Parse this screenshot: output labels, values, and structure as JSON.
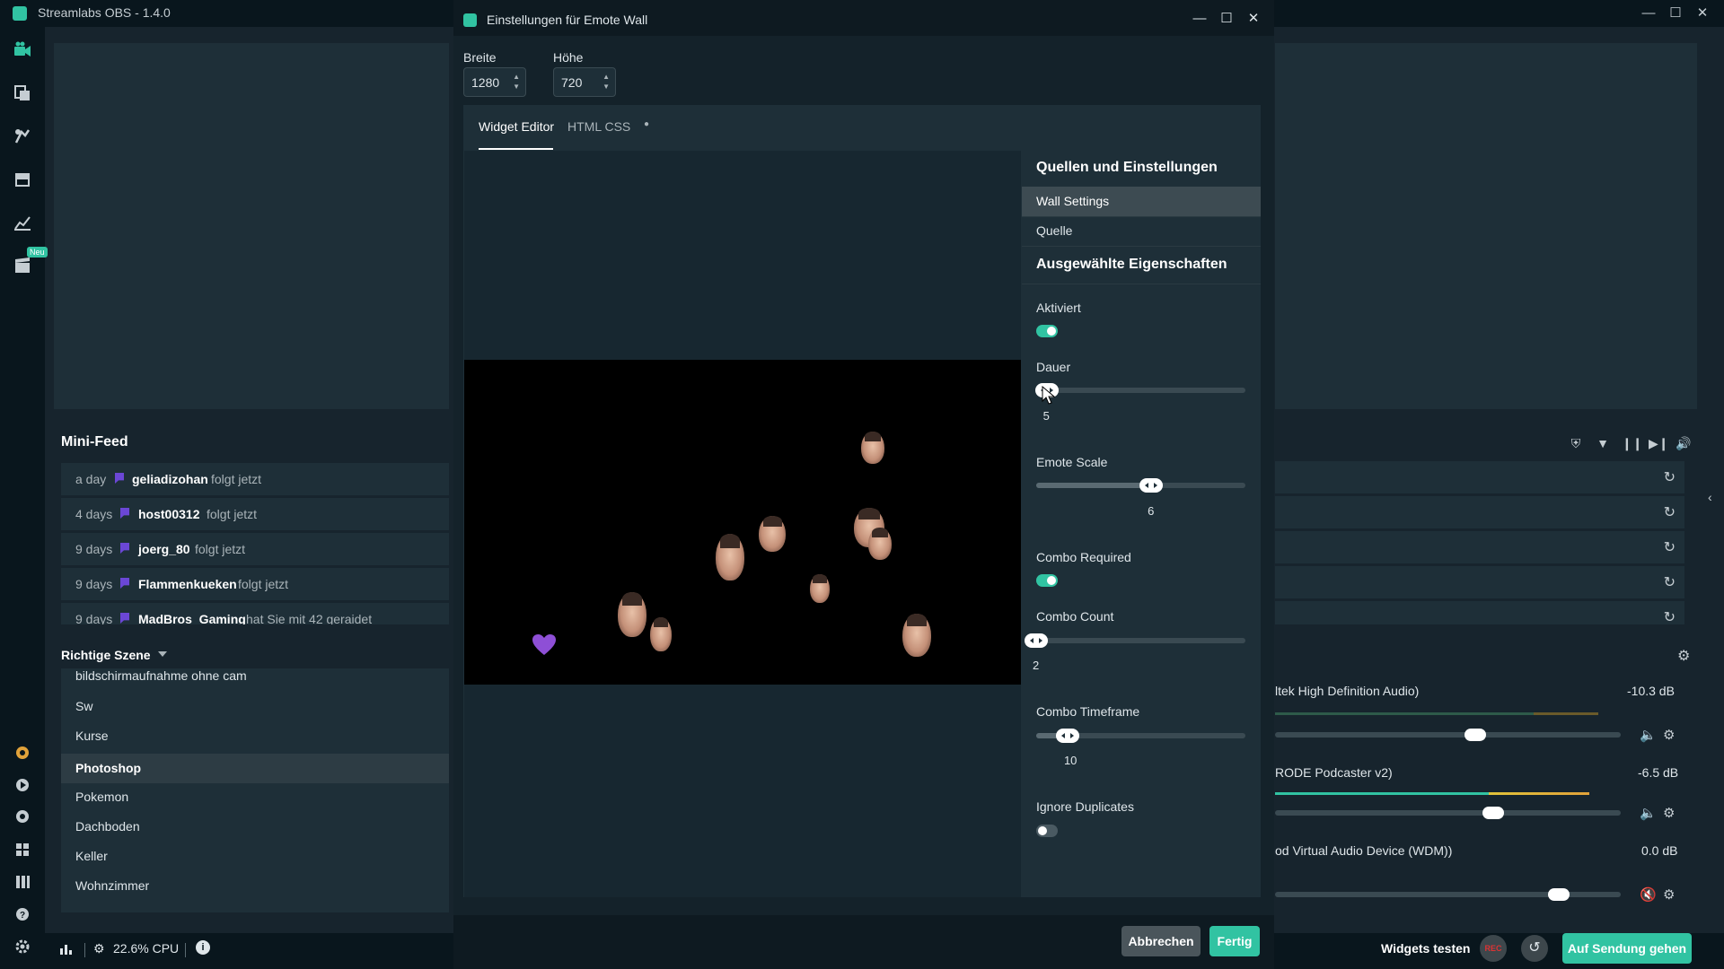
{
  "app": {
    "title": "Streamlabs OBS - 1.4.0",
    "nav_badge": "Neu",
    "window_controls": [
      "minimize-icon",
      "maximize-icon",
      "close-icon"
    ]
  },
  "mini_feed": {
    "title": "Mini-Feed",
    "items": [
      {
        "time": "a day",
        "user": "geliadizohan",
        "action": "folgt jetzt"
      },
      {
        "time": "4 days",
        "user": "host00312",
        "action": "folgt jetzt"
      },
      {
        "time": "9 days",
        "user": "joerg_80",
        "action": "folgt jetzt"
      },
      {
        "time": "9 days",
        "user": "Flammenkueken",
        "action": "folgt jetzt"
      },
      {
        "time": "9 days",
        "user": "MadBros_Gaming",
        "action": "hat Sie mit 42 geraidet"
      }
    ]
  },
  "scenes": {
    "header": "Richtige Szene",
    "items": [
      "bildschirmaufnahme ohne cam",
      "Sw",
      "Kurse",
      "Photoshop",
      "Pokemon",
      "Dachboden",
      "Keller",
      "Wohnzimmer"
    ],
    "selected": "Photoshop"
  },
  "mixer": {
    "sources": [
      {
        "name": "ltek High Definition Audio)",
        "db": "-10.3 dB",
        "level": 0.58
      },
      {
        "name": "RODE Podcaster v2)",
        "db": "-6.5 dB",
        "level": 0.63
      },
      {
        "name": "od Virtual Audio Device (WDM))",
        "db": "0.0 dB",
        "level": 0.82
      }
    ]
  },
  "status": {
    "cpu": "22.6% CPU",
    "widgets_test": "Widgets testen",
    "rec": "REC",
    "go_live": "Auf Sendung gehen"
  },
  "modal": {
    "title": "Einstellungen für Emote Wall",
    "width_label": "Breite",
    "width_value": "1280",
    "height_label": "Höhe",
    "height_value": "720",
    "tabs": [
      "Widget Editor",
      "HTML CSS"
    ],
    "active_tab": "Widget Editor",
    "sources_heading": "Quellen und Einstellungen",
    "menu": [
      "Wall Settings",
      "Quelle"
    ],
    "active_menu": "Wall Settings",
    "props_heading": "Ausgewählte Eigenschaften",
    "props": {
      "aktiviert": {
        "label": "Aktiviert",
        "on": true
      },
      "dauer": {
        "label": "Dauer",
        "value": "5",
        "fraction": 0.05
      },
      "emote_scale": {
        "label": "Emote Scale",
        "value": "6",
        "fraction": 0.55
      },
      "combo_required": {
        "label": "Combo Required",
        "on": true
      },
      "combo_count": {
        "label": "Combo Count",
        "value": "2",
        "fraction": 0.0
      },
      "combo_timeframe": {
        "label": "Combo Timeframe",
        "value": "10",
        "fraction": 0.15
      },
      "ignore_duplicates": {
        "label": "Ignore Duplicates",
        "on": false
      }
    },
    "cancel_label": "Abbrechen",
    "done_label": "Fertig"
  }
}
